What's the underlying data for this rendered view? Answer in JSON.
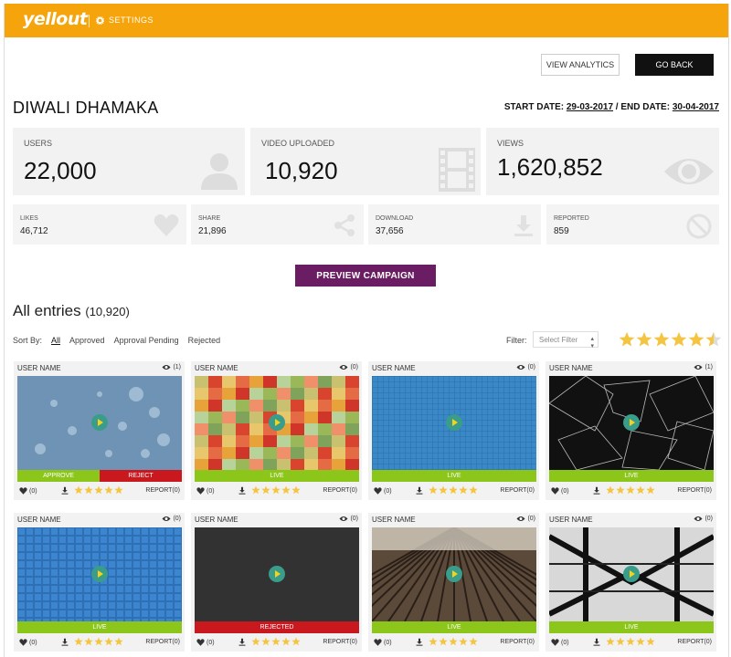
{
  "header": {
    "logo": "yellout",
    "settings": "SETTINGS"
  },
  "actions": {
    "view_analytics": "VIEW ANALYTICS",
    "go_back": "GO BACK"
  },
  "campaign": {
    "title": "DIWALI DHAMAKA",
    "start_label": "START DATE:",
    "start_date": "29-03-2017",
    "sep": " / ",
    "end_label": "END DATE:",
    "end_date": "30-04-2017"
  },
  "stats_big": [
    {
      "label": "USERS",
      "value": "22,000",
      "icon": "user-icon"
    },
    {
      "label": "VIDEO UPLOADED",
      "value": "10,920",
      "icon": "film-icon"
    },
    {
      "label": "VIEWS",
      "value": "1,620,852",
      "icon": "eye-icon"
    }
  ],
  "stats_small": [
    {
      "label": "LIKES",
      "value": "46,712",
      "icon": "heart-icon"
    },
    {
      "label": "SHARE",
      "value": "21,896",
      "icon": "share-icon"
    },
    {
      "label": "DOWNLOAD",
      "value": "37,656",
      "icon": "download-icon"
    },
    {
      "label": "REPORTED",
      "value": "859",
      "icon": "ban-icon"
    }
  ],
  "preview_button": "PREVIEW CAMPAIGN",
  "entries": {
    "title": "All entries",
    "count": "(10,920)"
  },
  "sort": {
    "label": "Sort By:",
    "options": [
      "All",
      "Approved",
      "Approval Pending",
      "Rejected"
    ]
  },
  "filter": {
    "label": "Filter:",
    "placeholder": "Select Filter"
  },
  "colors": {
    "brand": "#f5a50b",
    "live": "#8dc61b",
    "reject": "#c9191e",
    "preview": "#6b1d63",
    "star": "#f4c542"
  },
  "cards": [
    {
      "user": "USER NAME",
      "views": "(1)",
      "status": "pending",
      "approve": "APPROVE",
      "reject": "REJECT",
      "likes": "(0)",
      "report": "REPORT(0)",
      "thumb": "bokeh"
    },
    {
      "user": "USER NAME",
      "views": "(0)",
      "status": "live",
      "status_text": "LIVE",
      "likes": "(0)",
      "report": "REPORT(0)",
      "thumb": "pixels"
    },
    {
      "user": "USER NAME",
      "views": "(0)",
      "status": "live",
      "status_text": "LIVE",
      "likes": "(0)",
      "report": "REPORT(0)",
      "thumb": "blue-grid"
    },
    {
      "user": "USER NAME",
      "views": "(1)",
      "status": "live",
      "status_text": "LIVE",
      "likes": "(0)",
      "report": "REPORT(0)",
      "thumb": "dark-shapes"
    },
    {
      "user": "USER NAME",
      "views": "(0)",
      "status": "live",
      "status_text": "LIVE",
      "likes": "(0)",
      "report": "REPORT(0)",
      "thumb": "blue-tiles"
    },
    {
      "user": "USER NAME",
      "views": "(0)",
      "status": "rejected",
      "status_text": "REJECTED",
      "likes": "(0)",
      "report": "REPORT(0)",
      "thumb": "dark-texture"
    },
    {
      "user": "USER NAME",
      "views": "(0)",
      "status": "live",
      "status_text": "LIVE",
      "likes": "(0)",
      "report": "REPORT(0)",
      "thumb": "wood-rays"
    },
    {
      "user": "USER NAME",
      "views": "(0)",
      "status": "live",
      "status_text": "LIVE",
      "likes": "(0)",
      "report": "REPORT(0)",
      "thumb": "steel-beams"
    }
  ]
}
